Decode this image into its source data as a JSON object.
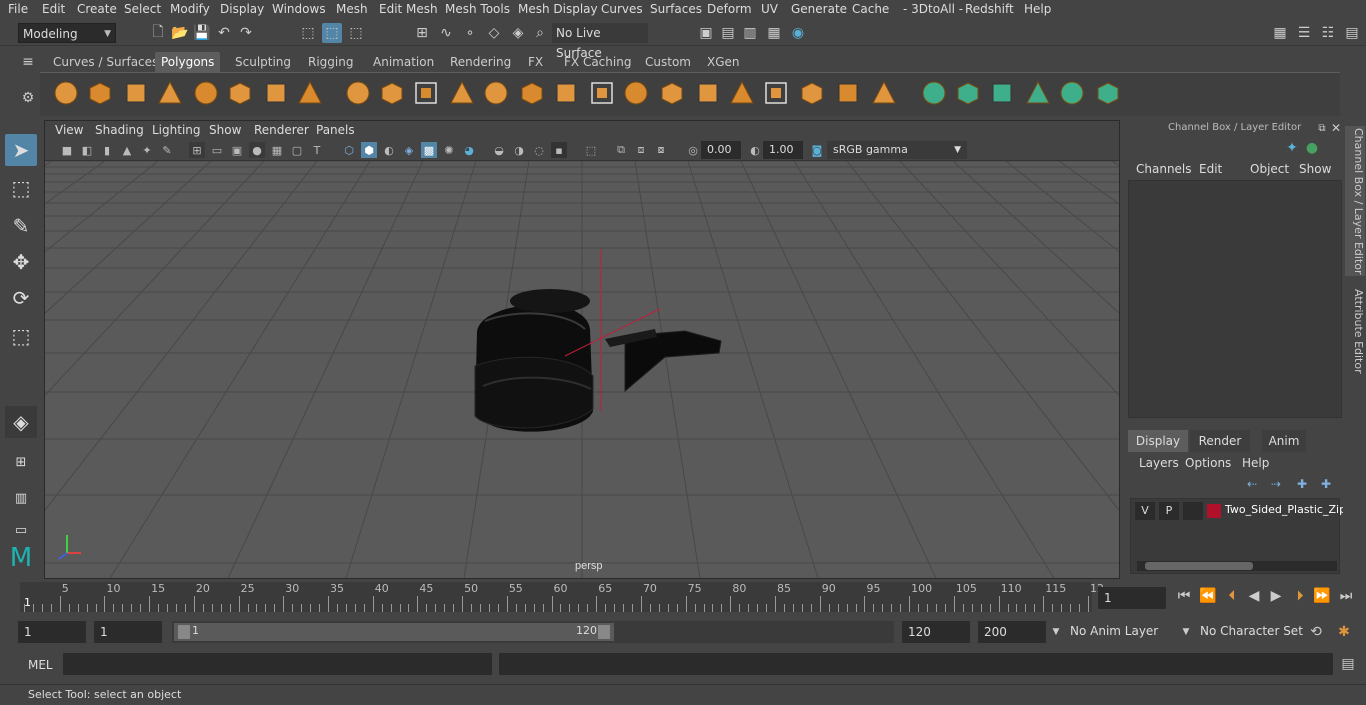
{
  "menu": [
    "File",
    "Edit",
    "Create",
    "Select",
    "Modify",
    "Display",
    "Windows",
    "Mesh",
    "Edit Mesh",
    "Mesh Tools",
    "Mesh Display",
    "Curves",
    "Surfaces",
    "Deform",
    "UV",
    "Generate",
    "Cache",
    "- 3DtoAll -",
    "Redshift",
    "Help"
  ],
  "status": {
    "mode": "Modeling",
    "live_surface": "No Live Surface"
  },
  "shelf_tabs": [
    "Curves / Surfaces",
    "Polygons",
    "Sculpting",
    "Rigging",
    "Animation",
    "Rendering",
    "FX",
    "FX Caching",
    "Custom",
    "XGen"
  ],
  "shelf_active": "Polygons",
  "viewport": {
    "menu": [
      "View",
      "Shading",
      "Lighting",
      "Show",
      "Renderer",
      "Panels"
    ],
    "exposure": "0.00",
    "gamma": "1.00",
    "color_space": "sRGB gamma",
    "camera_label": "persp"
  },
  "channel_box": {
    "title": "Channel Box / Layer Editor",
    "menu": [
      "Channels",
      "Edit",
      "Object",
      "Show"
    ]
  },
  "layer_editor": {
    "tabs": [
      "Display",
      "Render",
      "Anim"
    ],
    "active_tab": "Display",
    "menu": [
      "Layers",
      "Options",
      "Help"
    ],
    "layers": [
      {
        "v": "V",
        "p": "P",
        "name": "Two_Sided_Plastic_Zip",
        "color": "#b0102a"
      }
    ]
  },
  "side_tabs": [
    "Channel Box / Layer Editor",
    "Attribute Editor"
  ],
  "timeline": {
    "ticks": [
      "5",
      "10",
      "15",
      "20",
      "25",
      "30",
      "35",
      "40",
      "45",
      "50",
      "55",
      "60",
      "65",
      "70",
      "75",
      "80",
      "85",
      "90",
      "95",
      "100",
      "105",
      "110",
      "115",
      "12"
    ],
    "start_marker": "1",
    "current_frame": "1"
  },
  "range": {
    "start": "1",
    "playback_start": "1",
    "slider_start": "1",
    "slider_end": "120",
    "playback_end": "120",
    "end": "200",
    "anim_layer": "No Anim Layer",
    "character_set": "No Character Set"
  },
  "cmd": {
    "label": "MEL"
  },
  "help": "Select Tool: select an object",
  "colors": {
    "accent": "#5285a6",
    "shelf_orange": "#e0963f",
    "shelf_green": "#3fae8a"
  }
}
